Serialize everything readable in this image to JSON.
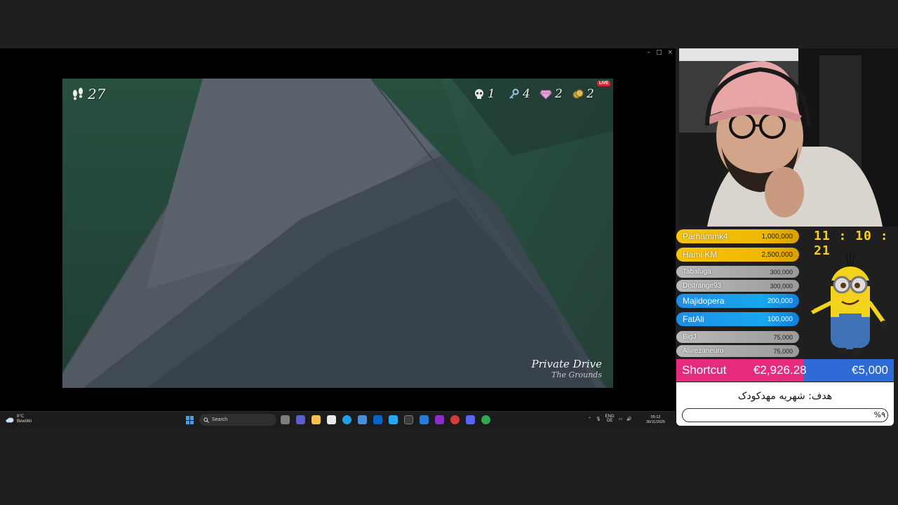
{
  "window": {
    "controls": [
      "–",
      "□",
      "×"
    ]
  },
  "game": {
    "hud": {
      "steps": "27",
      "skulls": "1",
      "keys": "4",
      "gems": "2",
      "coins": "2"
    },
    "live_badge": "LIVE",
    "location": {
      "name": "Private Drive",
      "area": "The Grounds"
    }
  },
  "taskbar": {
    "weather": {
      "temp": "8°C",
      "condition": "Bewölkt"
    },
    "search_placeholder": "Search",
    "apps": [
      "file-manager-icon",
      "teams-icon",
      "explorer-icon",
      "edge-icon",
      "copilot-icon",
      "outlook-icon",
      "photos-icon",
      "terminal-icon",
      "vscode-icon",
      "rider-icon",
      "chrome-dev-icon",
      "discord-icon",
      "chrome-icon"
    ],
    "tray": {
      "lang_top": "ENG",
      "lang_bottom": "DE"
    },
    "clock": {
      "time": "05:12",
      "date": "30/11/2025"
    }
  },
  "donations": [
    {
      "name": "Parhammk4",
      "amount": "1,000,000",
      "tier": "gold"
    },
    {
      "name": "Hami KM",
      "amount": "2,500,000",
      "tier": "gold"
    },
    {
      "name": "Tabaluga",
      "amount": "300,000",
      "tier": "grey"
    },
    {
      "name": "Drstrange93",
      "amount": "300,000",
      "tier": "grey"
    },
    {
      "name": "Majidopera",
      "amount": "200,000",
      "tier": "blue"
    },
    {
      "name": "FatAli",
      "amount": "100,000",
      "tier": "blue"
    },
    {
      "name": "BigJ",
      "amount": "75,000",
      "tier": "grey"
    },
    {
      "name": "Aliirezaneuro",
      "amount": "75,000",
      "tier": "grey"
    }
  ],
  "stream_clock": "11 : 10 : 21",
  "goal": {
    "label": "Shortcut",
    "current": "€2,926.28",
    "target": "€5,000",
    "progress": 0.585
  },
  "charity": {
    "title": "هدف: شهریه مهدکودک",
    "percent_label": "%۹",
    "progress": 0.09
  },
  "colors": {
    "gold": "#f7c30c",
    "blue": "#1e8ee6",
    "goal_fill": "#e62b7d",
    "goal_bg": "#2f6bd7",
    "clock": "#f7cf1f"
  }
}
